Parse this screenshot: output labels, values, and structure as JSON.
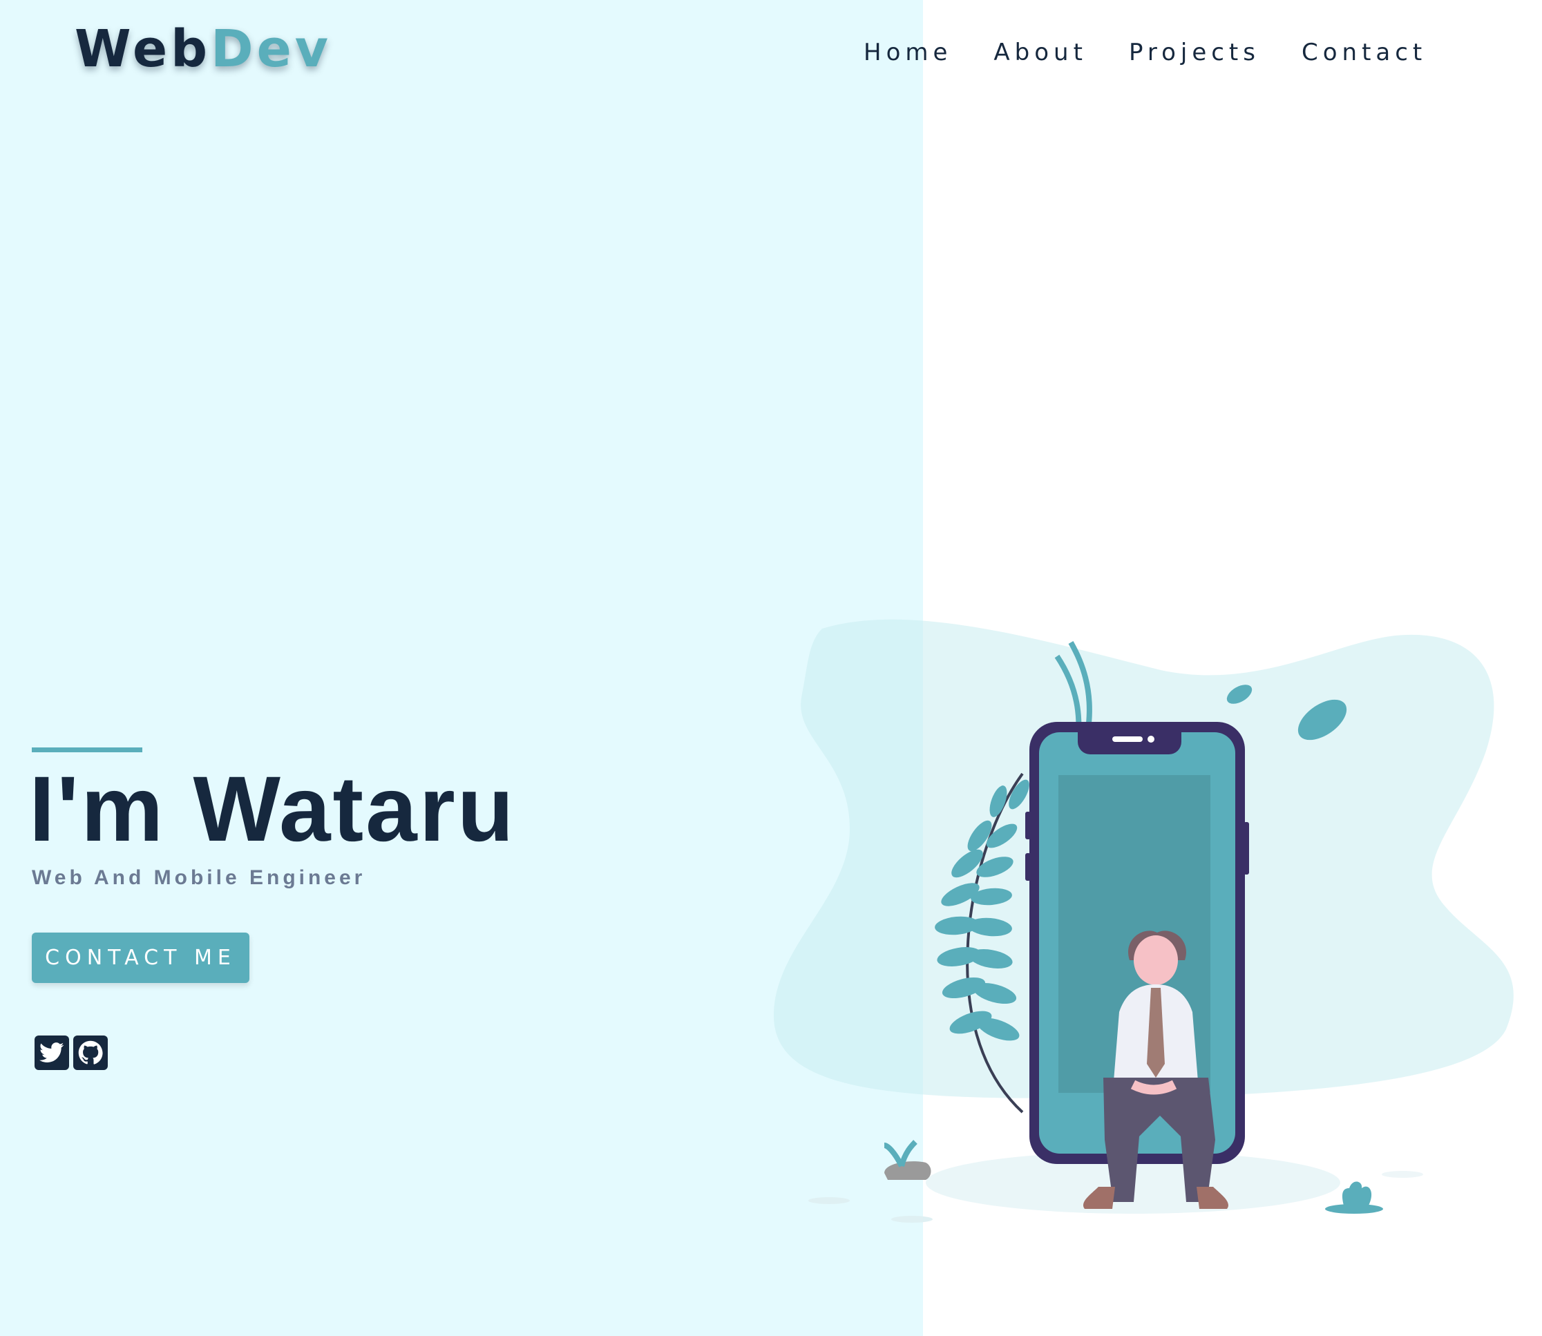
{
  "brand": {
    "part_a": "Web",
    "part_b": "Dev"
  },
  "nav": {
    "items": [
      {
        "label": "Home"
      },
      {
        "label": "About"
      },
      {
        "label": "Projects"
      },
      {
        "label": "Contact"
      }
    ]
  },
  "hero": {
    "title": "I'm Wataru",
    "subtitle": "Web And Mobile Engineer",
    "cta_label": "CONTACT ME"
  },
  "socials": [
    {
      "icon": "twitter-icon"
    },
    {
      "icon": "github-icon"
    }
  ],
  "colors": {
    "primary_dark": "#16283e",
    "accent": "#5aaebb",
    "left_panel": "#e4fafe",
    "muted_text": "#6b7a93",
    "phone_frame": "#3a2f66"
  }
}
